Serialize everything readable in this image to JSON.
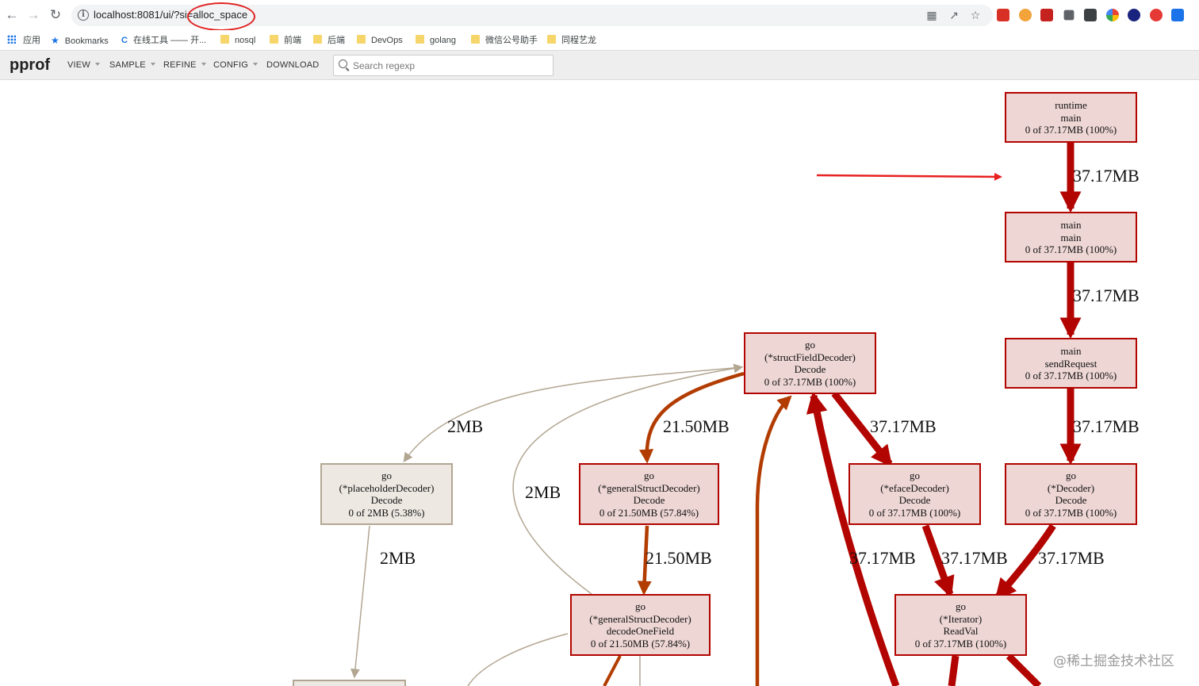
{
  "browser": {
    "url": "localhost:8081/ui/?si=alloc_space",
    "bookmarks": [
      "应用",
      "Bookmarks",
      "在线工具 —— 开...",
      "nosql",
      "前端",
      "后端",
      "DevOps",
      "golang",
      "微信公号助手",
      "同程艺龙"
    ]
  },
  "header": {
    "logo": "pprof",
    "menus": [
      "VIEW",
      "SAMPLE",
      "REFINE",
      "CONFIG",
      "DOWNLOAD"
    ],
    "search_placeholder": "Search regexp"
  },
  "graph": {
    "nodes": [
      {
        "id": "runtime-main",
        "lines": [
          "runtime",
          "main",
          "0 of 37.17MB (100%)"
        ],
        "hot": true
      },
      {
        "id": "main-main",
        "lines": [
          "main",
          "main",
          "0 of 37.17MB (100%)"
        ],
        "hot": true
      },
      {
        "id": "main-sendRequest",
        "lines": [
          "main",
          "sendRequest",
          "0 of 37.17MB (100%)"
        ],
        "hot": true
      },
      {
        "id": "go-structFieldDecoder-Decode",
        "lines": [
          "go",
          "(*structFieldDecoder)",
          "Decode",
          "0 of 37.17MB (100%)"
        ],
        "hot": true
      },
      {
        "id": "go-placeholderDecoder-Decode",
        "lines": [
          "go",
          "(*placeholderDecoder)",
          "Decode",
          "0 of 2MB (5.38%)"
        ],
        "hot": false
      },
      {
        "id": "go-generalStructDecoder-Decode",
        "lines": [
          "go",
          "(*generalStructDecoder)",
          "Decode",
          "0 of 21.50MB (57.84%)"
        ],
        "hot": true
      },
      {
        "id": "go-efaceDecoder-Decode",
        "lines": [
          "go",
          "(*efaceDecoder)",
          "Decode",
          "0 of 37.17MB (100%)"
        ],
        "hot": true
      },
      {
        "id": "go-Decoder-Decode",
        "lines": [
          "go",
          "(*Decoder)",
          "Decode",
          "0 of 37.17MB (100%)"
        ],
        "hot": true
      },
      {
        "id": "go-generalStructDecoder-decodeOneField",
        "lines": [
          "go",
          "(*generalStructDecoder)",
          "decodeOneField",
          "0 of 21.50MB (57.84%)"
        ],
        "hot": true
      },
      {
        "id": "go-Iterator-ReadVal",
        "lines": [
          "go",
          "(*Iterator)",
          "ReadVal",
          "0 of 37.17MB (100%)"
        ],
        "hot": true
      }
    ],
    "edge_labels": [
      "37.17MB",
      "37.17MB",
      "37.17MB",
      "2MB",
      "21.50MB",
      "37.17MB",
      "2MB",
      "2MB",
      "21.50MB",
      "37.17MB",
      "37.17MB",
      "37.17MB"
    ]
  },
  "watermark": "@稀土掘金技术社区"
}
